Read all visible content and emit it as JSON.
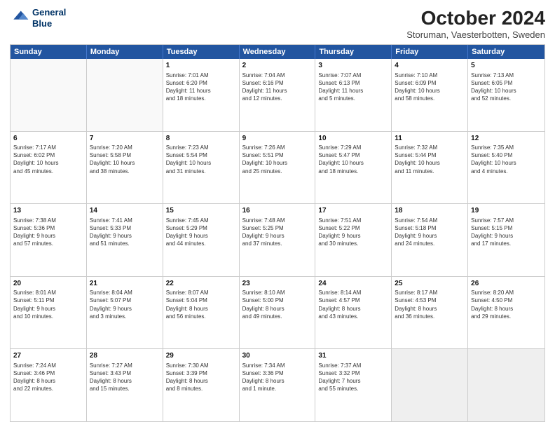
{
  "logo": {
    "line1": "General",
    "line2": "Blue"
  },
  "title": "October 2024",
  "subtitle": "Storuman, Vaesterbotten, Sweden",
  "header_days": [
    "Sunday",
    "Monday",
    "Tuesday",
    "Wednesday",
    "Thursday",
    "Friday",
    "Saturday"
  ],
  "weeks": [
    [
      {
        "day": "",
        "info": ""
      },
      {
        "day": "",
        "info": ""
      },
      {
        "day": "1",
        "info": "Sunrise: 7:01 AM\nSunset: 6:20 PM\nDaylight: 11 hours\nand 18 minutes."
      },
      {
        "day": "2",
        "info": "Sunrise: 7:04 AM\nSunset: 6:16 PM\nDaylight: 11 hours\nand 12 minutes."
      },
      {
        "day": "3",
        "info": "Sunrise: 7:07 AM\nSunset: 6:13 PM\nDaylight: 11 hours\nand 5 minutes."
      },
      {
        "day": "4",
        "info": "Sunrise: 7:10 AM\nSunset: 6:09 PM\nDaylight: 10 hours\nand 58 minutes."
      },
      {
        "day": "5",
        "info": "Sunrise: 7:13 AM\nSunset: 6:05 PM\nDaylight: 10 hours\nand 52 minutes."
      }
    ],
    [
      {
        "day": "6",
        "info": "Sunrise: 7:17 AM\nSunset: 6:02 PM\nDaylight: 10 hours\nand 45 minutes."
      },
      {
        "day": "7",
        "info": "Sunrise: 7:20 AM\nSunset: 5:58 PM\nDaylight: 10 hours\nand 38 minutes."
      },
      {
        "day": "8",
        "info": "Sunrise: 7:23 AM\nSunset: 5:54 PM\nDaylight: 10 hours\nand 31 minutes."
      },
      {
        "day": "9",
        "info": "Sunrise: 7:26 AM\nSunset: 5:51 PM\nDaylight: 10 hours\nand 25 minutes."
      },
      {
        "day": "10",
        "info": "Sunrise: 7:29 AM\nSunset: 5:47 PM\nDaylight: 10 hours\nand 18 minutes."
      },
      {
        "day": "11",
        "info": "Sunrise: 7:32 AM\nSunset: 5:44 PM\nDaylight: 10 hours\nand 11 minutes."
      },
      {
        "day": "12",
        "info": "Sunrise: 7:35 AM\nSunset: 5:40 PM\nDaylight: 10 hours\nand 4 minutes."
      }
    ],
    [
      {
        "day": "13",
        "info": "Sunrise: 7:38 AM\nSunset: 5:36 PM\nDaylight: 9 hours\nand 57 minutes."
      },
      {
        "day": "14",
        "info": "Sunrise: 7:41 AM\nSunset: 5:33 PM\nDaylight: 9 hours\nand 51 minutes."
      },
      {
        "day": "15",
        "info": "Sunrise: 7:45 AM\nSunset: 5:29 PM\nDaylight: 9 hours\nand 44 minutes."
      },
      {
        "day": "16",
        "info": "Sunrise: 7:48 AM\nSunset: 5:25 PM\nDaylight: 9 hours\nand 37 minutes."
      },
      {
        "day": "17",
        "info": "Sunrise: 7:51 AM\nSunset: 5:22 PM\nDaylight: 9 hours\nand 30 minutes."
      },
      {
        "day": "18",
        "info": "Sunrise: 7:54 AM\nSunset: 5:18 PM\nDaylight: 9 hours\nand 24 minutes."
      },
      {
        "day": "19",
        "info": "Sunrise: 7:57 AM\nSunset: 5:15 PM\nDaylight: 9 hours\nand 17 minutes."
      }
    ],
    [
      {
        "day": "20",
        "info": "Sunrise: 8:01 AM\nSunset: 5:11 PM\nDaylight: 9 hours\nand 10 minutes."
      },
      {
        "day": "21",
        "info": "Sunrise: 8:04 AM\nSunset: 5:07 PM\nDaylight: 9 hours\nand 3 minutes."
      },
      {
        "day": "22",
        "info": "Sunrise: 8:07 AM\nSunset: 5:04 PM\nDaylight: 8 hours\nand 56 minutes."
      },
      {
        "day": "23",
        "info": "Sunrise: 8:10 AM\nSunset: 5:00 PM\nDaylight: 8 hours\nand 49 minutes."
      },
      {
        "day": "24",
        "info": "Sunrise: 8:14 AM\nSunset: 4:57 PM\nDaylight: 8 hours\nand 43 minutes."
      },
      {
        "day": "25",
        "info": "Sunrise: 8:17 AM\nSunset: 4:53 PM\nDaylight: 8 hours\nand 36 minutes."
      },
      {
        "day": "26",
        "info": "Sunrise: 8:20 AM\nSunset: 4:50 PM\nDaylight: 8 hours\nand 29 minutes."
      }
    ],
    [
      {
        "day": "27",
        "info": "Sunrise: 7:24 AM\nSunset: 3:46 PM\nDaylight: 8 hours\nand 22 minutes."
      },
      {
        "day": "28",
        "info": "Sunrise: 7:27 AM\nSunset: 3:43 PM\nDaylight: 8 hours\nand 15 minutes."
      },
      {
        "day": "29",
        "info": "Sunrise: 7:30 AM\nSunset: 3:39 PM\nDaylight: 8 hours\nand 8 minutes."
      },
      {
        "day": "30",
        "info": "Sunrise: 7:34 AM\nSunset: 3:36 PM\nDaylight: 8 hours\nand 1 minute."
      },
      {
        "day": "31",
        "info": "Sunrise: 7:37 AM\nSunset: 3:32 PM\nDaylight: 7 hours\nand 55 minutes."
      },
      {
        "day": "",
        "info": ""
      },
      {
        "day": "",
        "info": ""
      }
    ]
  ]
}
